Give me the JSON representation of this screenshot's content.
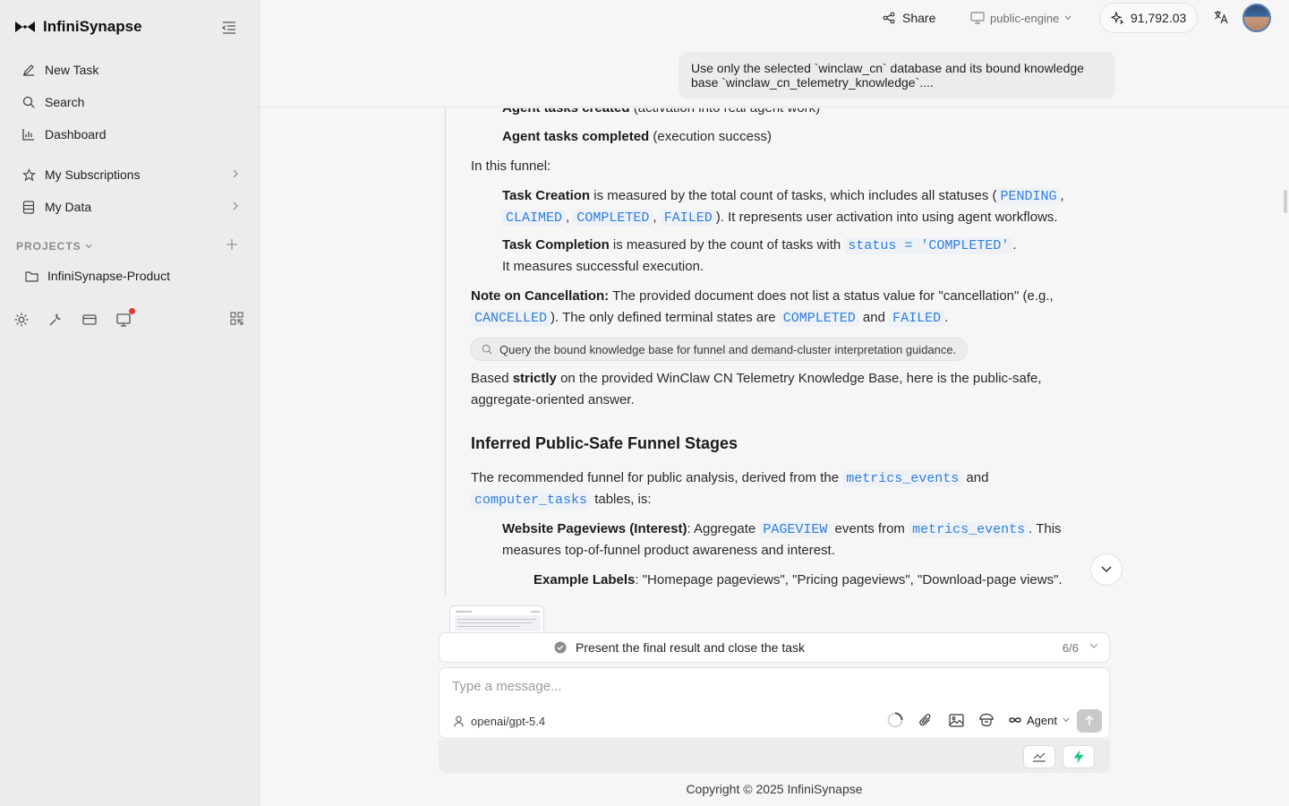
{
  "sidebar": {
    "brand": "InfiniSynapse",
    "nav": [
      {
        "label": "New Task",
        "icon": "pencil-icon"
      },
      {
        "label": "Search",
        "icon": "search-icon"
      },
      {
        "label": "Dashboard",
        "icon": "bar-chart-icon"
      },
      {
        "label": "My Subscriptions",
        "icon": "star-icon"
      },
      {
        "label": "My Data",
        "icon": "database-icon"
      }
    ],
    "projects_label": "PROJECTS",
    "project": "InfiniSynapse-Product",
    "bottom_icons": [
      "gear-icon",
      "wrench-icon",
      "card-icon",
      "monitor-icon",
      "qr-code-icon"
    ]
  },
  "topbar": {
    "share": "Share",
    "engine": "public-engine",
    "credits": "91,792.03",
    "user_message": "Use only the selected `winclaw_cn` database and its bound knowledge base `winclaw_cn_telemetry_knowledge`...."
  },
  "content": {
    "l1_bold": "Agent tasks created",
    "l1_rest": " (activation into real agent work)",
    "l2_bold": "Agent tasks completed",
    "l2_rest": " (execution success)",
    "l3": "In this funnel:",
    "l4_bold": "Task Creation",
    "l4_rest": " is measured by the total count of tasks, which includes all statuses (",
    "code_pending": "PENDING",
    "sep_comma": ",",
    "code_claimed": "CLAIMED",
    "code_completed": "COMPLETED",
    "code_failed": "FAILED",
    "l5_rest": "). It represents user activation into using agent workflows.",
    "l6_bold": "Task Completion",
    "l6_rest": " is measured by the count of tasks with ",
    "code_status": "status = 'COMPLETED'",
    "period": ".",
    "l7": "It measures successful execution.",
    "l8_bold": "Note on Cancellation:",
    "l8_rest": " The provided document does not list a status value for \"cancellation\" (e.g.,",
    "code_cancelled": "CANCELLED",
    "l9_rest": "). The only defined terminal states are ",
    "and_word": " and ",
    "tool_call": "Query the bound knowledge base for funnel and demand-cluster interpretation guidance.",
    "l10_pre": "Based ",
    "l10_bold": "strictly",
    "l10_rest": " on the provided WinClaw CN Telemetry Knowledge Base, here is the public-safe,",
    "l11": "aggregate-oriented answer.",
    "heading": "Inferred Public-Safe Funnel Stages",
    "l12_rest": "The recommended funnel for public analysis, derived from the ",
    "code_metrics": "metrics_events",
    "and_tail": " and",
    "code_computer": "computer_tasks",
    "l13_rest": " tables, is:",
    "l14_bold": "Website Pageviews (Interest)",
    "l14_rest": ": Aggregate ",
    "code_pageview": "PAGEVIEW",
    "l14_mid": " events from ",
    "l14_end": ". This",
    "l15": "measures top-of-funnel product awareness and interest.",
    "l16_bold": "Example Labels",
    "l16_rest": ": \"Homepage pageviews\", \"Pricing pageviews\", \"Download-page views\"."
  },
  "plan": {
    "step_label": "Present the final result and close the task",
    "count": "6/6"
  },
  "composer": {
    "placeholder": "Type a message...",
    "model": "openai/gpt-5.4",
    "mode": "Agent"
  },
  "footer": "Copyright © 2025 InfiniSynapse",
  "colors": {
    "code": "#2f7de1",
    "accent_green": "#19c37d",
    "notification": "#e53935"
  }
}
